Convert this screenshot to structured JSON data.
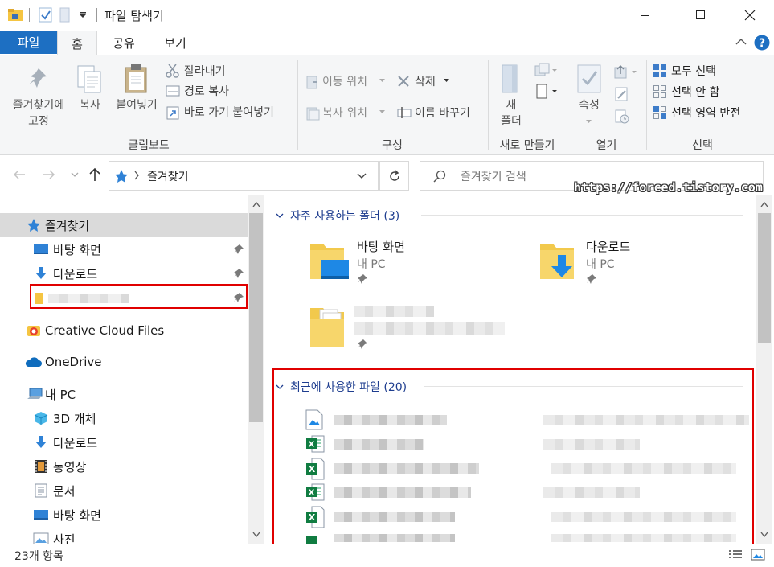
{
  "window": {
    "title": "파일 탐색기"
  },
  "tabs": {
    "file": "파일",
    "home": "홈",
    "share": "공유",
    "view": "보기"
  },
  "ribbon": {
    "clipboard": {
      "pin_line1": "즐겨찾기에",
      "pin_line2": "고정",
      "copy": "복사",
      "paste": "붙여넣기",
      "cut": "잘라내기",
      "copy_path": "경로 복사",
      "paste_shortcut": "바로 가기 붙여넣기",
      "label": "클립보드"
    },
    "organize": {
      "move_to": "이동 위치",
      "delete": "삭제",
      "copy_to": "복사 위치",
      "rename": "이름 바꾸기",
      "label": "구성"
    },
    "new": {
      "new_folder_line1": "새",
      "new_folder_line2": "폴더",
      "label": "새로 만들기"
    },
    "open": {
      "properties": "속성",
      "label": "열기"
    },
    "select": {
      "select_all": "모두 선택",
      "select_none": "선택 안 함",
      "invert": "선택 영역 반전",
      "label": "선택"
    }
  },
  "address": {
    "path": "즐겨찾기",
    "search_placeholder": "즐겨찾기 검색",
    "watermark": "https://forced.tistory.com"
  },
  "nav": {
    "quick_access": "즐겨찾기",
    "desktop": "바탕 화면",
    "downloads": "다운로드",
    "creative_cloud": "Creative Cloud Files",
    "onedrive": "OneDrive",
    "this_pc": "내 PC",
    "objects3d": "3D 개체",
    "pc_downloads": "다운로드",
    "videos": "동영상",
    "documents": "문서",
    "pc_desktop": "바탕 화면",
    "pictures": "사진"
  },
  "content": {
    "frequent_header": "자주 사용하는 폴더 (3)",
    "recent_header": "최근에 사용한 파일 (20)",
    "tiles": [
      {
        "name": "바탕 화면",
        "sub": "내 PC"
      },
      {
        "name": "다운로드",
        "sub": "내 PC"
      }
    ]
  },
  "status": {
    "count": "23개 항목"
  },
  "colors": {
    "accent": "#1d6fc2",
    "highlight": "#e00000",
    "header_text": "#1e3d8f"
  }
}
